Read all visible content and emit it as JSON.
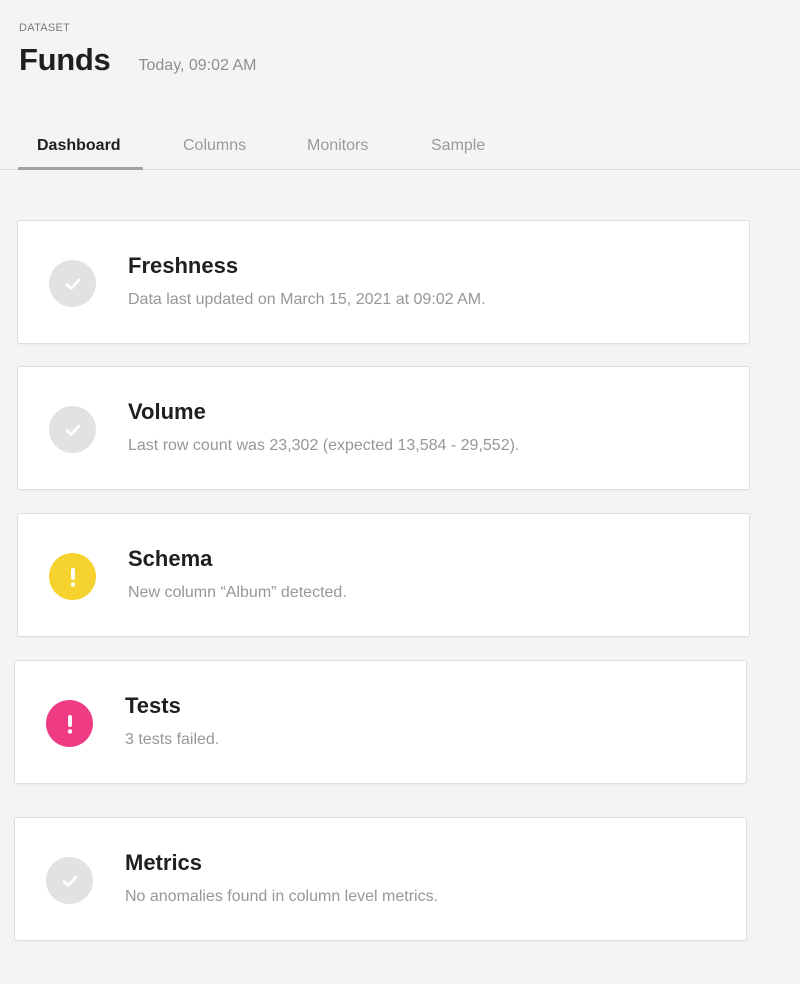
{
  "header": {
    "eyebrow": "DATASET",
    "title": "Funds",
    "timestamp": "Today, 09:02 AM"
  },
  "tabs": [
    {
      "label": "Dashboard",
      "active": true
    },
    {
      "label": "Columns",
      "active": false
    },
    {
      "label": "Monitors",
      "active": false
    },
    {
      "label": "Sample",
      "active": false
    }
  ],
  "cards": [
    {
      "title": "Freshness",
      "description": "Data last updated on March 15, 2021 at 09:02 AM.",
      "status": "ok",
      "icon": "check-icon"
    },
    {
      "title": "Volume",
      "description": "Last row count was 23,302 (expected 13,584 - 29,552).",
      "status": "ok",
      "icon": "check-icon"
    },
    {
      "title": "Schema",
      "description": "New column “Album” detected.",
      "status": "warning",
      "icon": "exclamation-icon"
    },
    {
      "title": "Tests",
      "description": "3 tests failed.",
      "status": "error",
      "icon": "exclamation-icon"
    },
    {
      "title": "Metrics",
      "description": "No anomalies found in column level metrics.",
      "status": "ok",
      "icon": "check-icon"
    }
  ],
  "colors": {
    "ok": "#e2e2e2",
    "warning": "#f6d22e",
    "error": "#ee3b84",
    "tab_underline": "#9ea4a6"
  }
}
